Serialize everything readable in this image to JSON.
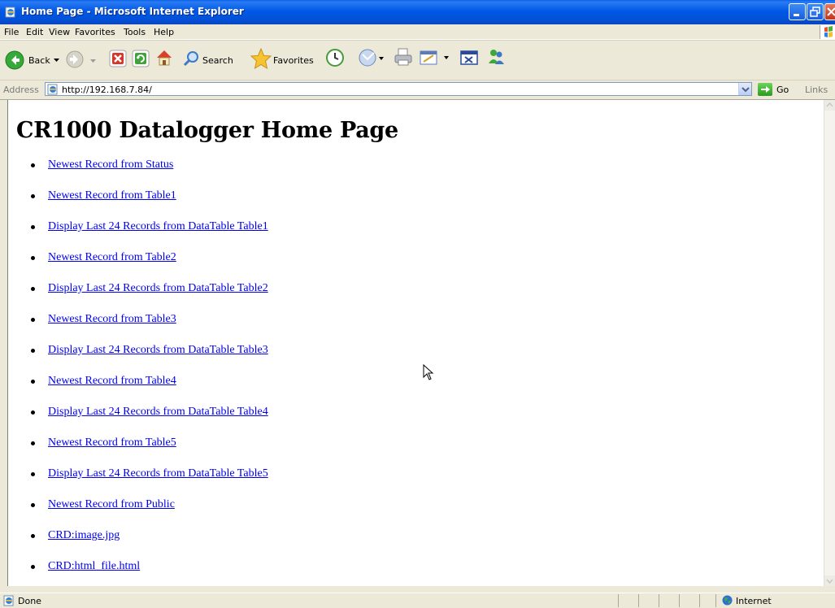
{
  "window": {
    "title": "Home Page - Microsoft Internet Explorer"
  },
  "menu": [
    "File",
    "Edit",
    "View",
    "Favorites",
    "Tools",
    "Help"
  ],
  "toolbar": {
    "back_label": "Back",
    "search_label": "Search",
    "favorites_label": "Favorites"
  },
  "address": {
    "label": "Address",
    "url": "http://192.168.7.84/",
    "go_label": "Go",
    "links_label": "Links"
  },
  "page": {
    "title": "CR1000 Datalogger Home Page",
    "links": [
      "Newest Record from Status",
      "Newest Record from Table1",
      "Display Last 24 Records from DataTable Table1",
      "Newest Record from Table2",
      "Display Last 24 Records from DataTable Table2",
      "Newest Record from Table3",
      "Display Last 24 Records from DataTable Table3",
      "Newest Record from Table4",
      "Display Last 24 Records from DataTable Table4",
      "Newest Record from Table5",
      "Display Last 24 Records from DataTable Table5",
      "Newest Record from Public",
      "CRD:image.jpg",
      "CRD:html_file.html"
    ]
  },
  "status": {
    "text": "Done",
    "zone": "Internet"
  },
  "colors": {
    "link": "#0000EE",
    "titlebar": "#0058E6"
  }
}
